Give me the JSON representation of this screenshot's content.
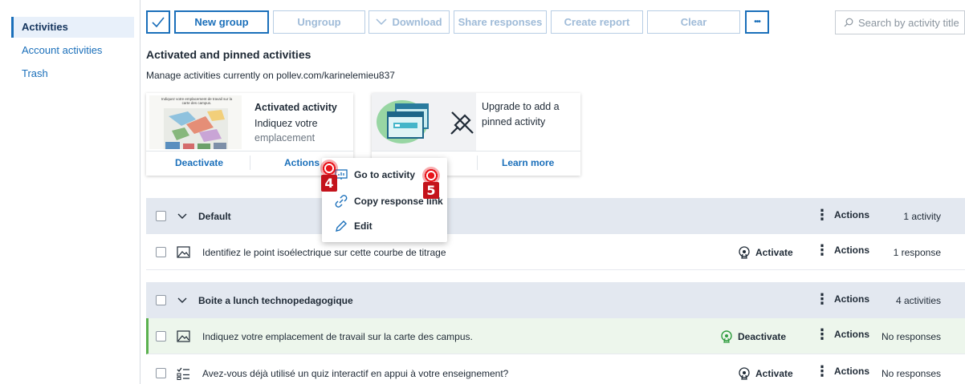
{
  "sidebar": {
    "items": [
      {
        "label": "Activities",
        "active": true
      },
      {
        "label": "Account activities",
        "active": false
      },
      {
        "label": "Trash",
        "active": false
      }
    ]
  },
  "toolbar": {
    "new_group": "New group",
    "ungroup": "Ungroup",
    "download": "Download",
    "share_responses": "Share responses",
    "create_report": "Create report",
    "clear": "Clear",
    "more": "•••",
    "search_placeholder": "Search by activity title"
  },
  "header": {
    "title": "Activated and pinned activities",
    "subtitle": "Manage activities currently on pollev.com/karinelemieu837"
  },
  "activated_card": {
    "thumbnail_caption": "Indiquez votre emplacement de travail sur la carte des campus.",
    "title": "Activated activity",
    "line1": "Indiquez votre",
    "line2": "emplacement",
    "deactivate": "Deactivate",
    "actions": "Actions"
  },
  "pinned_card": {
    "text_line1": "Upgrade to add a",
    "text_line2": "pinned activity",
    "learn_more": "Learn more"
  },
  "menu": {
    "items": [
      "Go to activity",
      "Copy response link",
      "Edit"
    ]
  },
  "groups": [
    {
      "name": "Default",
      "actions": "Actions",
      "count": "1 activity"
    },
    {
      "name": "Boite a lunch technopedagogique",
      "actions": "Actions",
      "count": "4 activities"
    }
  ],
  "rows": [
    {
      "title": "Identifiez le point isoélectrique sur cette courbe de titrage",
      "toggle": "Activate",
      "actions": "Actions",
      "responses": "1 response"
    },
    {
      "title": "Indiquez votre emplacement de travail sur la carte des campus.",
      "toggle": "Deactivate",
      "actions": "Actions",
      "responses": "No responses"
    },
    {
      "title": "Avez-vous déjà utilisé un quiz interactif en appui à votre enseignement?",
      "toggle": "Activate",
      "actions": "Actions",
      "responses": "No responses"
    }
  ],
  "markers": [
    "4",
    "5"
  ],
  "colors": {
    "accent": "#1a6fba",
    "group_bg": "#e3e8f0",
    "active_row_bg": "#edf6ec",
    "active_green": "#5bb14f",
    "marker_red": "#c4131b"
  }
}
